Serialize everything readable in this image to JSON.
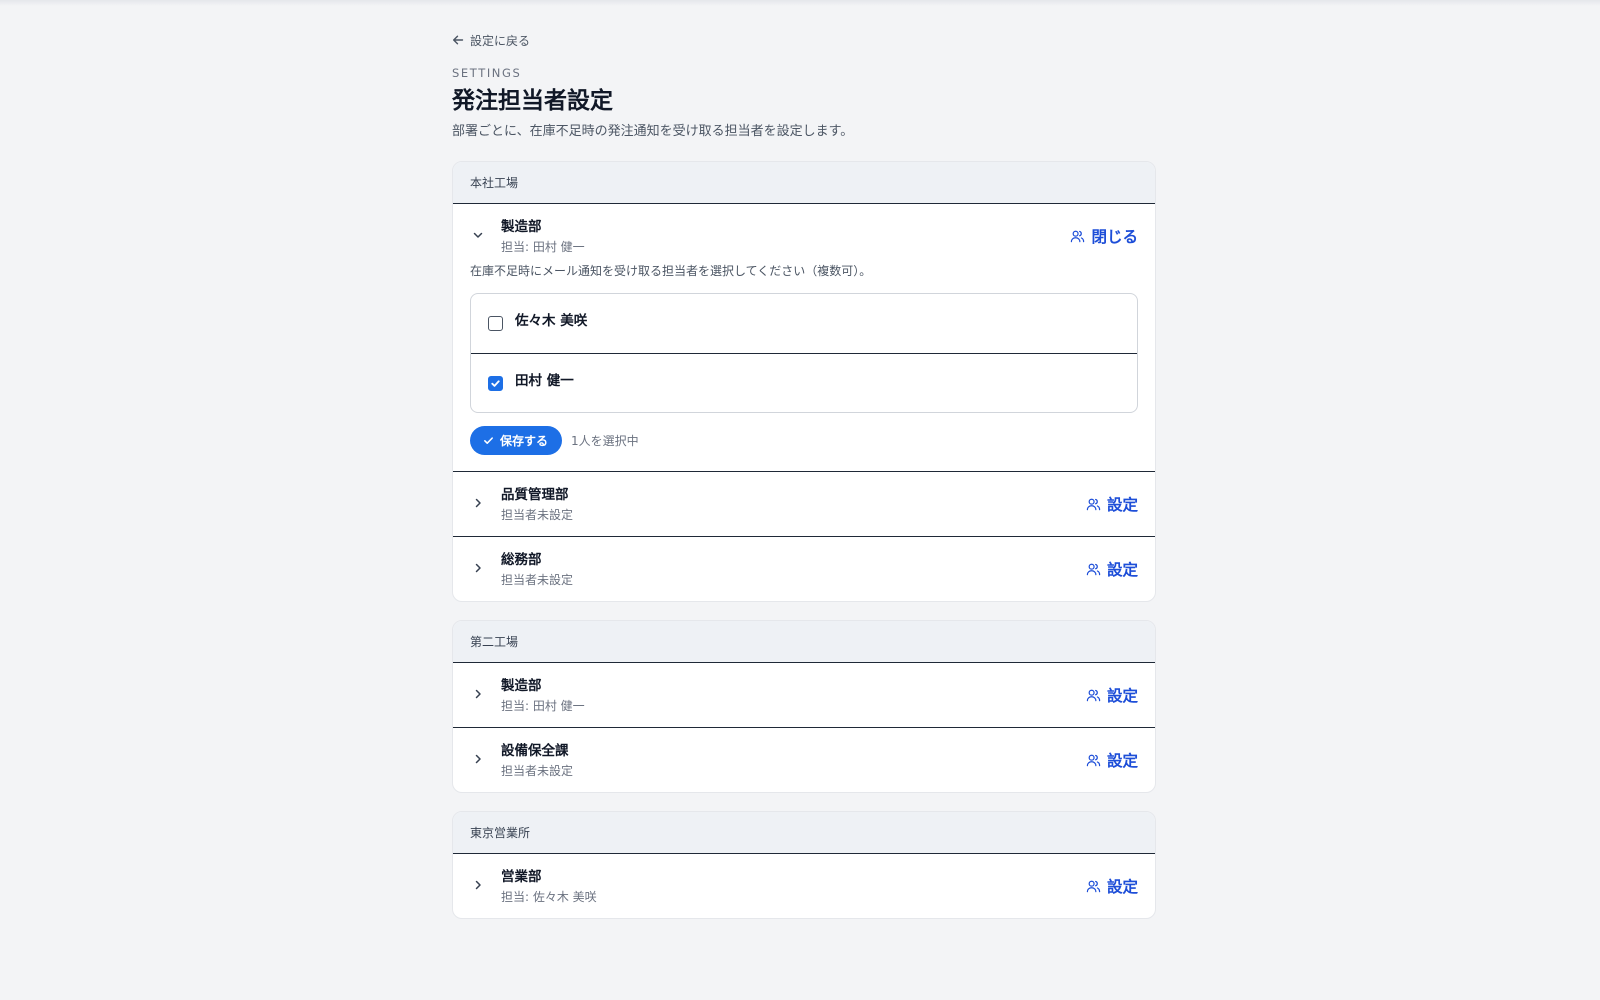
{
  "back_link": "設定に戻る",
  "eyebrow": "SETTINGS",
  "title": "発注担当者設定",
  "description": "部署ごとに、在庫不足時の発注通知を受け取る担当者を設定します。",
  "colors": {
    "accent": "#1d6fe6",
    "link": "#1d4ed8",
    "background": "#f3f4f6"
  },
  "locations": [
    {
      "name": "本社工場",
      "departments": [
        {
          "name": "製造部",
          "sub": "担当: 田村 健一",
          "action": "閉じる",
          "expanded": true,
          "hint": "在庫不足時にメール通知を受け取る担当者を選択してください（複数可）。",
          "people": [
            {
              "name": "佐々木 美咲",
              "checked": false
            },
            {
              "name": "田村 健一",
              "checked": true
            }
          ],
          "save_label": "保存する",
          "selection_status": "1人を選択中"
        },
        {
          "name": "品質管理部",
          "sub": "担当者未設定",
          "action": "設定"
        },
        {
          "name": "総務部",
          "sub": "担当者未設定",
          "action": "設定"
        }
      ]
    },
    {
      "name": "第二工場",
      "departments": [
        {
          "name": "製造部",
          "sub": "担当: 田村 健一",
          "action": "設定"
        },
        {
          "name": "設備保全課",
          "sub": "担当者未設定",
          "action": "設定"
        }
      ]
    },
    {
      "name": "東京営業所",
      "departments": [
        {
          "name": "営業部",
          "sub": "担当: 佐々木 美咲",
          "action": "設定"
        }
      ]
    }
  ]
}
